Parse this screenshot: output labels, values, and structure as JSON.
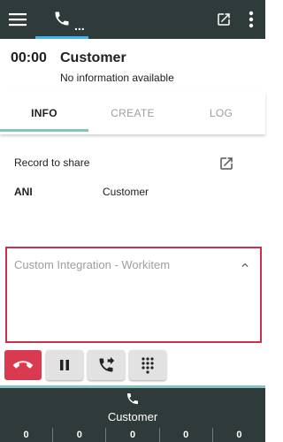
{
  "header": {
    "menu_icon": "hamburger-menu-icon",
    "phone_icon": "phone-icon",
    "phone_dots": "...",
    "popout_icon": "open-in-new-icon",
    "more_icon": "more-vertical-icon",
    "accent_color": "#3fb6f0",
    "bar_color": "#2f3b3a"
  },
  "call": {
    "timer": "00:00",
    "caller": "Customer",
    "info": "No information available"
  },
  "tabs": [
    {
      "label": "INFO",
      "active": true
    },
    {
      "label": "CREATE",
      "active": false
    },
    {
      "label": "LOG",
      "active": false
    }
  ],
  "info": {
    "record_label": "Record to share",
    "record_icon": "open-in-new-icon",
    "ani_label": "ANI",
    "ani_value": "Customer"
  },
  "integration": {
    "title": "Custom Integration - Workitem",
    "toggle_icon": "chevron-up-icon",
    "border_color": "#c8314a"
  },
  "actions": {
    "hangup_icon": "hang-up-icon",
    "hold_icon": "pause-icon",
    "transfer_icon": "phone-forward-icon",
    "dialpad_icon": "dialpad-icon",
    "hangup_color": "#d93a4f"
  },
  "bottom": {
    "phone_icon": "phone-icon",
    "name": "Customer",
    "counts": [
      "0",
      "0",
      "0",
      "0",
      "0"
    ]
  }
}
